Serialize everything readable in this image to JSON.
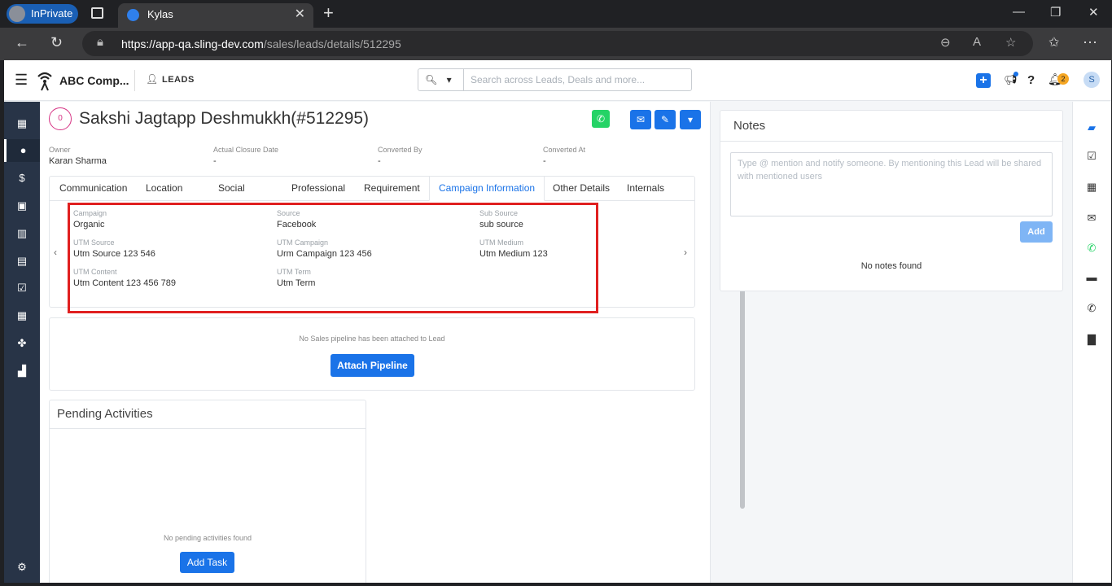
{
  "browser": {
    "inprivate_label": "InPrivate",
    "tab_title": "Kylas",
    "url_host": "https://app-qa.sling-dev.com",
    "url_path": "/sales/leads/details/512295"
  },
  "header": {
    "company": "ABC Comp...",
    "module": "LEADS",
    "search_placeholder": "Search across Leads, Deals and more...",
    "notification_count": "2",
    "avatar_initial": "S"
  },
  "lead": {
    "badge": "0",
    "name": "Sakshi Jagtapp Deshmukkh(#512295)",
    "fields": [
      {
        "label": "Owner",
        "value": "Karan Sharma"
      },
      {
        "label": "Actual Closure Date",
        "value": "-"
      },
      {
        "label": "Converted By",
        "value": "-"
      },
      {
        "label": "Converted At",
        "value": "-"
      }
    ]
  },
  "tabs": [
    "Communication",
    "Location",
    "Social",
    "Professional",
    "Requirement",
    "Campaign Information",
    "Other Details",
    "Internals"
  ],
  "campaign": [
    {
      "label": "Campaign",
      "value": "Organic"
    },
    {
      "label": "Source",
      "value": "Facebook"
    },
    {
      "label": "Sub Source",
      "value": "sub source"
    },
    {
      "label": "UTM Source",
      "value": "Utm Source 123 546"
    },
    {
      "label": "UTM Campaign",
      "value": "Urm Campaign 123 456"
    },
    {
      "label": "UTM Medium",
      "value": "Utm Medium 123"
    },
    {
      "label": "UTM Content",
      "value": "Utm Content 123 456 789"
    },
    {
      "label": "UTM Term",
      "value": "Utm Term"
    }
  ],
  "pipeline": {
    "empty_text": "No Sales pipeline has been attached to Lead",
    "attach_label": "Attach Pipeline"
  },
  "pending": {
    "title": "Pending Activities",
    "empty_text": "No pending activities found",
    "add_task_label": "Add Task"
  },
  "notes": {
    "title": "Notes",
    "placeholder": "Type @ mention and notify someone. By mentioning this Lead will be shared with mentioned users",
    "add_label": "Add",
    "empty_text": "No notes found"
  },
  "icons": {
    "left_sidebar": [
      "dashboard-icon",
      "user-icon",
      "money-bag-icon",
      "contact-card-icon",
      "building-icon",
      "clipboard-icon",
      "checkbox-icon",
      "calendar-icon",
      "handshake-icon",
      "report-icon",
      "settings-icon"
    ],
    "right_sidebar": [
      "note-icon",
      "task-icon",
      "calendar-icon",
      "email-icon",
      "whatsapp-icon",
      "chat-icon",
      "phone-icon",
      "folder-icon"
    ]
  },
  "colors": {
    "primary": "#1a73e8",
    "highlight": "#e02020",
    "whatsapp": "#25d366",
    "sidebar": "#283447"
  }
}
